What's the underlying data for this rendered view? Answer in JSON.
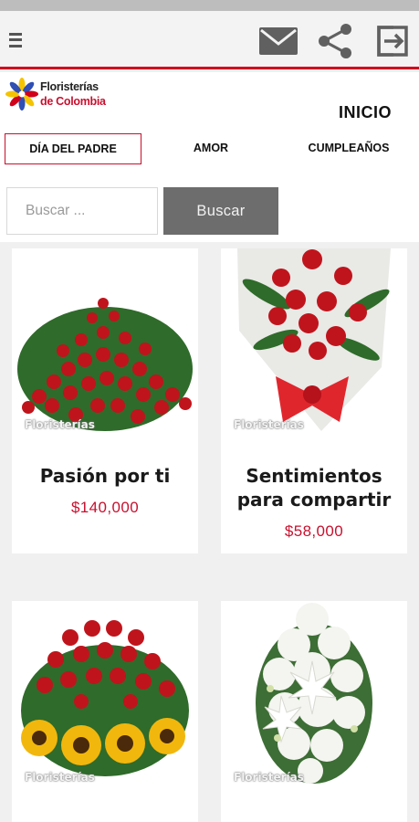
{
  "app_bar": {
    "menu_icon": "hamburger-icon",
    "mail_icon": "envelope-icon",
    "share_icon": "share-icon",
    "exit_icon": "exit-icon"
  },
  "logo": {
    "line1": "Floristerías",
    "line2": "de Colombia"
  },
  "nav": {
    "home": "INICIO",
    "items": [
      {
        "label": "DÍA DEL PADRE",
        "active": true
      },
      {
        "label": "AMOR",
        "active": false
      },
      {
        "label": "CUMPLEAÑOS",
        "active": false
      }
    ]
  },
  "search": {
    "placeholder": "Buscar ...",
    "button_label": "Buscar"
  },
  "products": [
    {
      "name": "Pasión por ti",
      "price": "$140,000",
      "watermark": "Floristerías"
    },
    {
      "name": "Sentimientos para compartir",
      "price": "$58,000",
      "watermark": "Floristerías"
    },
    {
      "name": "",
      "price": "",
      "watermark": "Floristerías"
    },
    {
      "name": "",
      "price": "",
      "watermark": "Floristerías"
    }
  ],
  "colors": {
    "accent": "#c8102e",
    "search_button": "#6d6d6d",
    "background": "#f0f0f0"
  }
}
